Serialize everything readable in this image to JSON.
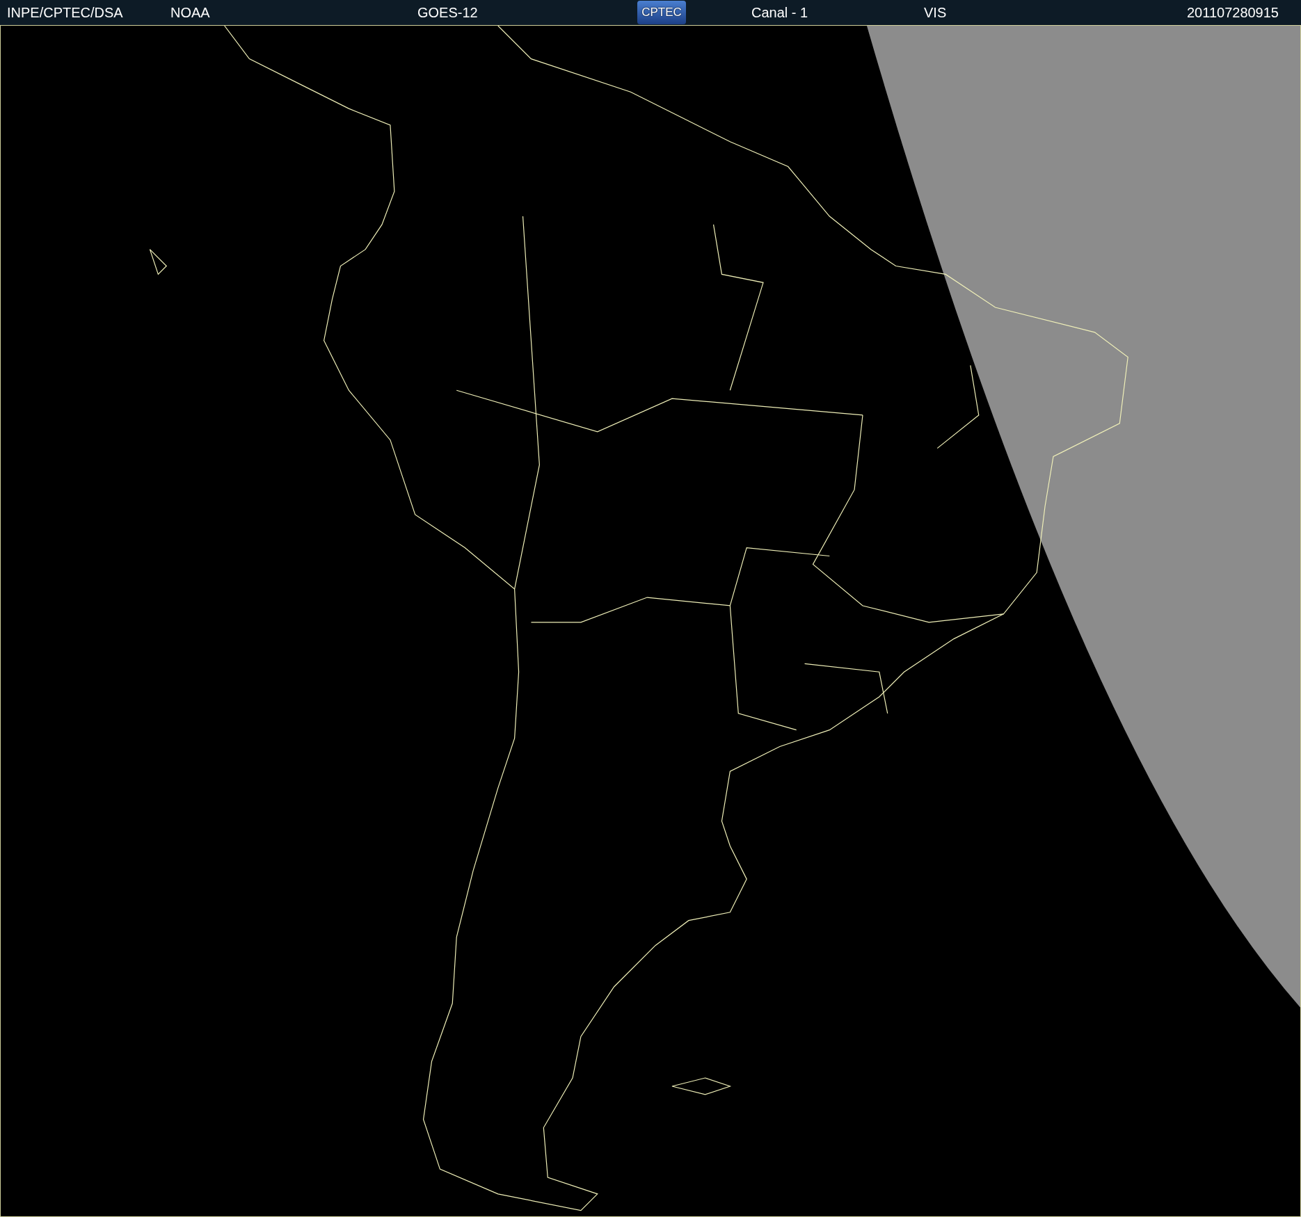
{
  "header": {
    "source": "INPE/CPTEC/DSA",
    "agency": "NOAA",
    "satellite": "GOES-12",
    "logo": "CPTEC",
    "channel": "Canal - 1",
    "band": "VIS",
    "timestamp": "201107280915"
  }
}
